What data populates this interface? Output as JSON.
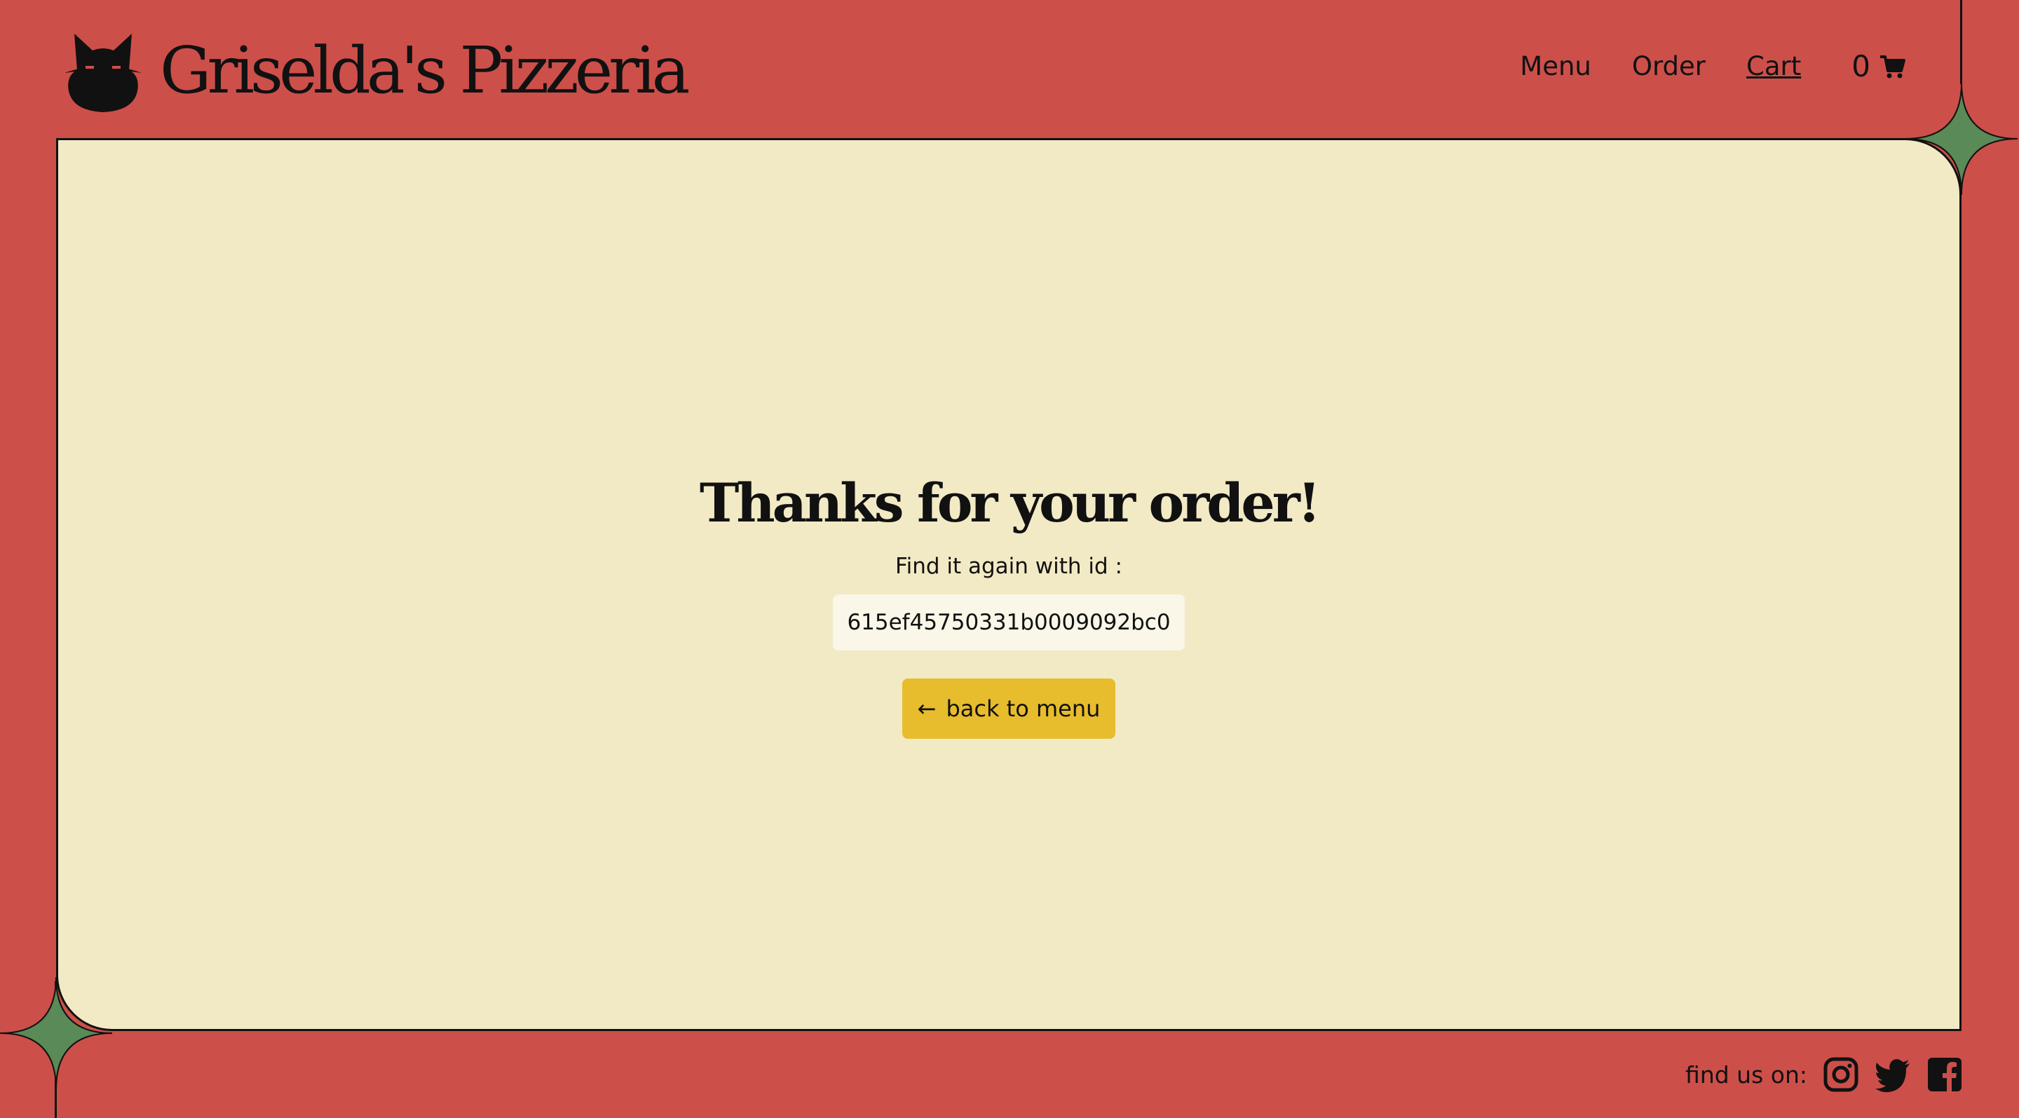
{
  "header": {
    "brand": "Griselda's Pizzeria",
    "nav": [
      {
        "label": "Menu"
      },
      {
        "label": "Order"
      },
      {
        "label": "Cart"
      }
    ],
    "cart_count": "0"
  },
  "main": {
    "title": "Thanks for your order!",
    "subtitle": "Find it again with id :",
    "order_id": "615ef45750331b0009092bc0",
    "back_button_arrow": "←",
    "back_button_label": "back to menu"
  },
  "footer": {
    "find_us": "find us on:",
    "socials": [
      "instagram-icon",
      "twitter-icon",
      "facebook-icon"
    ]
  },
  "colors": {
    "background": "#cd4f4a",
    "panel": "#f2eac5",
    "accent_button": "#e7bc2d",
    "star": "#5a8a57",
    "id_box": "#faf6e8"
  }
}
